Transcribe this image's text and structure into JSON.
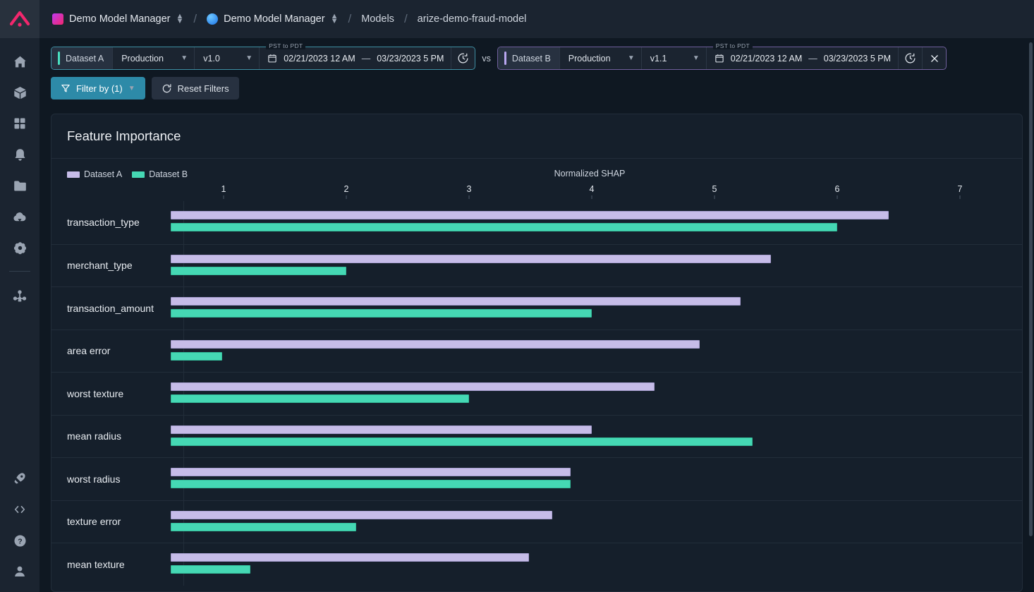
{
  "rail": {
    "logo": "arize-logo-icon",
    "top_items": [
      {
        "name": "home-icon",
        "label": "Home"
      },
      {
        "name": "models-cube-icon",
        "label": "Models"
      },
      {
        "name": "dashboards-grid-icon",
        "label": "Dashboards"
      },
      {
        "name": "monitors-bell-icon",
        "label": "Monitors"
      },
      {
        "name": "projects-folder-icon",
        "label": "Projects"
      },
      {
        "name": "upload-cloud-icon",
        "label": "Data Upload"
      },
      {
        "name": "settings-gear-icon",
        "label": "Settings"
      },
      {
        "name": "tracing-node-icon",
        "label": "Tracing"
      }
    ],
    "bottom_items": [
      {
        "name": "rocket-icon",
        "label": "What's New"
      },
      {
        "name": "code-brackets-icon",
        "label": "Developers"
      },
      {
        "name": "help-question-icon",
        "label": "Help"
      },
      {
        "name": "user-account-icon",
        "label": "Account"
      }
    ]
  },
  "breadcrumb": {
    "space": "Demo Model Manager",
    "org": "Demo Model Manager",
    "section": "Models",
    "model": "arize-demo-fraud-model"
  },
  "controls": {
    "dataset_a": {
      "tag": "Dataset A",
      "environment": "Production",
      "version": "v1.0",
      "timezone_label": "PST to PDT",
      "date_start": "02/21/2023 12 AM",
      "date_sep": "—",
      "date_end": "03/23/2023 5 PM",
      "clock_icon": "clock-history-icon",
      "calendar_icon": "calendar-icon",
      "accent": "#49e0c0"
    },
    "vs_label": "vs",
    "dataset_b": {
      "tag": "Dataset B",
      "environment": "Production",
      "version": "v1.1",
      "timezone_label": "PST to PDT",
      "date_start": "02/21/2023 12 AM",
      "date_sep": "—",
      "date_end": "03/23/2023 5 PM",
      "clock_icon": "clock-history-icon",
      "calendar_icon": "calendar-icon",
      "close_icon": "close-x-icon",
      "accent": "#b9a6f0"
    },
    "filter_button": {
      "label": "Filter by (1)",
      "icon": "filter-funnel-icon",
      "chevron": "chevron-down-icon",
      "color": "#2d8aa8"
    },
    "reset_button": {
      "label": "Reset Filters",
      "icon": "refresh-icon"
    }
  },
  "card": {
    "title": "Feature Importance"
  },
  "chart_data": {
    "type": "bar",
    "orientation": "horizontal",
    "title": "Feature Importance",
    "xlabel": "Normalized SHAP",
    "ylabel": "",
    "xlim": [
      0,
      7.5
    ],
    "xticks": [
      1,
      2,
      3,
      4,
      5,
      6,
      7
    ],
    "grid": false,
    "legend_position": "top-left",
    "legend": [
      "Dataset A",
      "Dataset B"
    ],
    "colors": {
      "Dataset A": "#c6bce8",
      "Dataset B": "#45d8b4"
    },
    "categories": [
      "transaction_type",
      "merchant_type",
      "transaction_amount",
      "area error",
      "worst texture",
      "mean radius",
      "worst radius",
      "texture error",
      "mean texture"
    ],
    "series": [
      {
        "name": "Dataset A",
        "values": [
          6.42,
          5.46,
          5.21,
          4.88,
          4.51,
          4.0,
          3.83,
          3.68,
          3.49
        ]
      },
      {
        "name": "Dataset B",
        "values": [
          6.0,
          2.0,
          4.0,
          0.99,
          3.0,
          5.31,
          3.83,
          2.08,
          1.22
        ]
      }
    ],
    "bar_start_value": 0.57
  }
}
